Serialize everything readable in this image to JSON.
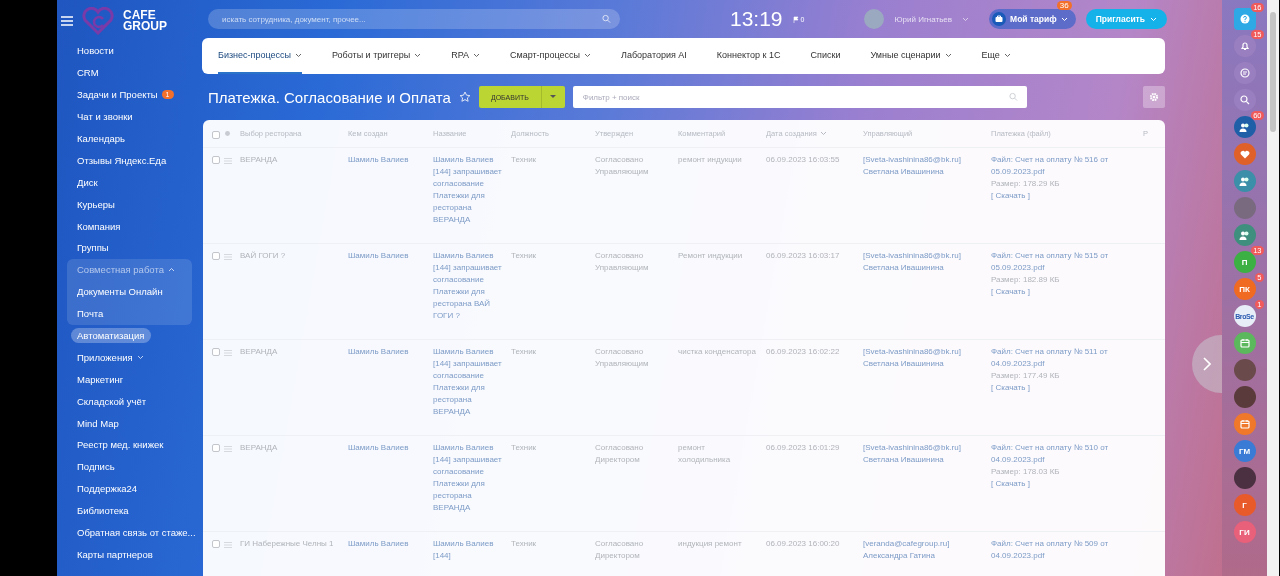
{
  "logo": {
    "lines": [
      "CAFE",
      "GROUP"
    ]
  },
  "header": {
    "search": {
      "placeholder": "искать сотрудника, документ, прочее..."
    },
    "clock": "13:19",
    "flag_count": "0",
    "user_name": "Юрий Игнатьев",
    "tariff": {
      "label": "Мой тариф",
      "badge": "36"
    },
    "invite": "Пригласить"
  },
  "sidebar": {
    "items": [
      {
        "kind": "link",
        "label": "Новости",
        "selected": false
      },
      {
        "kind": "link",
        "label": "CRM",
        "selected": false
      },
      {
        "kind": "link",
        "label": "Задачи и Проекты",
        "badge": "1",
        "selected": false
      },
      {
        "kind": "link",
        "label": "Чат и звонки",
        "selected": false
      },
      {
        "kind": "link",
        "label": "Календарь",
        "selected": false
      },
      {
        "kind": "link",
        "label": "Отзывы Яндекс.Еда",
        "selected": false
      },
      {
        "kind": "link",
        "label": "Диск",
        "selected": false
      },
      {
        "kind": "link",
        "label": "Курьеры",
        "selected": false
      },
      {
        "kind": "link",
        "label": "Компания",
        "selected": false
      },
      {
        "kind": "link",
        "label": "Группы",
        "selected": false
      },
      {
        "kind": "group",
        "label": "Совместная работа",
        "expanded": true,
        "selected": false,
        "children": [
          {
            "kind": "link",
            "label": "Документы Онлайн",
            "selected": false
          },
          {
            "kind": "link",
            "label": "Почта",
            "selected": false
          }
        ]
      },
      {
        "kind": "link",
        "label": "Автоматизация",
        "selected": true
      },
      {
        "kind": "group",
        "label": "Приложения",
        "expanded": false,
        "selected": false
      },
      {
        "kind": "link",
        "label": "Маркетинг",
        "selected": false
      },
      {
        "kind": "link",
        "label": "Складской учёт",
        "selected": false
      },
      {
        "kind": "link",
        "label": "Mind Map",
        "selected": false
      },
      {
        "kind": "link",
        "label": "Реестр мед. книжек",
        "selected": false
      },
      {
        "kind": "link",
        "label": "Подпись",
        "selected": false
      },
      {
        "kind": "link",
        "label": "Поддержка24",
        "selected": false
      },
      {
        "kind": "link",
        "label": "Библиотека",
        "selected": false
      },
      {
        "kind": "link",
        "label": "Обратная связь от стаже...",
        "selected": false
      },
      {
        "kind": "link",
        "label": "Карты партнеров",
        "selected": false
      }
    ]
  },
  "nav": {
    "tabs": [
      {
        "label": "Бизнес-процессы",
        "dropdown": true,
        "selected": true
      },
      {
        "label": "Роботы и триггеры",
        "dropdown": true,
        "selected": false
      },
      {
        "label": "RPA",
        "dropdown": true,
        "selected": false
      },
      {
        "label": "Смарт-процессы",
        "dropdown": true,
        "selected": false
      },
      {
        "label": "Лаборатория AI",
        "dropdown": false,
        "selected": false
      },
      {
        "label": "Коннектор к 1С",
        "dropdown": false,
        "selected": false
      },
      {
        "label": "Списки",
        "dropdown": false,
        "selected": false
      },
      {
        "label": "Умные сценарии",
        "dropdown": true,
        "selected": false
      },
      {
        "label": "Еще",
        "dropdown": true,
        "selected": false
      }
    ]
  },
  "page": {
    "title": "Платежка. Согласование и Оплата",
    "starred": false,
    "add_button": "ДОБАВИТЬ",
    "filter": {
      "placeholder": "Фильтр + поиск"
    }
  },
  "table": {
    "select_all_checked": false,
    "columns": [
      {
        "label": "Выбор ресторана",
        "sorted": false
      },
      {
        "label": "Кем создан",
        "sorted": false
      },
      {
        "label": "Название",
        "sorted": false
      },
      {
        "label": "Должность",
        "sorted": false
      },
      {
        "label": "Утвержден",
        "sorted": false
      },
      {
        "label": "Комментарий",
        "sorted": false
      },
      {
        "label": "Дата создания",
        "sorted": true
      },
      {
        "label": "Управляющий",
        "sorted": false
      },
      {
        "label": "Платежка (файл)",
        "sorted": false
      },
      {
        "label": "Р",
        "sorted": false
      }
    ],
    "rows": [
      {
        "checked": false,
        "restaurant": "ВЕРАНДА",
        "creator": "Шамиль Валиев",
        "title": "Шамиль Валиев [144] запрашивает согласование Платежки для ресторана ВЕРАНДА",
        "position": "Техник",
        "approval": "Согласовано Управляющим",
        "comment": "ремонт индукции",
        "created": "06.09.2023 16:03:55",
        "manager": "[Sveta-ivashinina86@bk.ru] Светлана Ивашинина",
        "file": "Файл: Счет на оплату № 516 от 05.09.2023.pdf",
        "file_size": "Размер: 178.29 КБ",
        "download": "[ Скачать ]"
      },
      {
        "checked": false,
        "restaurant": "ВАЙ ГОГИ ?",
        "creator": "Шамиль Валиев",
        "title": "Шамиль Валиев [144] запрашивает согласование Платежки для ресторана ВАЙ ГОГИ ?",
        "position": "Техник",
        "approval": "Согласовано Управляющим",
        "comment": "Ремонт индукции",
        "created": "06.09.2023 16:03:17",
        "manager": "[Sveta-ivashinina86@bk.ru] Светлана Ивашинина",
        "file": "Файл: Счет на оплату № 515 от 05.09.2023.pdf",
        "file_size": "Размер: 182.89 КБ",
        "download": "[ Скачать ]"
      },
      {
        "checked": false,
        "restaurant": "ВЕРАНДА",
        "creator": "Шамиль Валиев",
        "title": "Шамиль Валиев [144] запрашивает согласование Платежки для ресторана ВЕРАНДА",
        "position": "Техник",
        "approval": "Согласовано Управляющим",
        "comment": "чистка конденсатора",
        "created": "06.09.2023 16:02:22",
        "manager": "[Sveta-ivashinina86@bk.ru] Светлана Ивашинина",
        "file": "Файл: Счет на оплату № 511 от 04.09.2023.pdf",
        "file_size": "Размер: 177.49 КБ",
        "download": "[ Скачать ]"
      },
      {
        "checked": false,
        "restaurant": "ВЕРАНДА",
        "creator": "Шамиль Валиев",
        "title": "Шамиль Валиев [144] запрашивает согласование Платежки для ресторана ВЕРАНДА",
        "position": "Техник",
        "approval": "Согласовано Директором",
        "comment": "ремонт холодильника",
        "created": "06.09.2023 16:01:29",
        "manager": "[Sveta-ivashinina86@bk.ru] Светлана Ивашинина",
        "file": "Файл: Счет на оплату № 510 от 04.09.2023.pdf",
        "file_size": "Размер: 178.03 КБ",
        "download": "[ Скачать ]"
      },
      {
        "checked": false,
        "restaurant": "ГИ Набережные Челны 1",
        "creator": "Шамиль Валиев",
        "title": "Шамиль Валиев [144]",
        "position": "Техник",
        "approval": "Согласовано Директором",
        "comment": "индукция ремонт",
        "created": "06.09.2023 16:00:20",
        "manager": "[veranda@cafegroup.ru] Александра Гатина",
        "file": "Файл: Счет на оплату № 509 от 04.09.2023.pdf"
      }
    ]
  },
  "right_rail": {
    "items": [
      {
        "kind": "help",
        "badge": "16",
        "color": "#2fa8e6"
      },
      {
        "kind": "bell",
        "badge": "15",
        "color": "#9a7fc0"
      },
      {
        "kind": "chat",
        "color": "#9a7fc0"
      },
      {
        "kind": "search",
        "color": "#9a7fc0"
      },
      {
        "kind": "group",
        "badge": "60",
        "color": "#1f5fa8"
      },
      {
        "kind": "heart",
        "color": "#e0602a"
      },
      {
        "kind": "group",
        "color": "#3b8fa8"
      },
      {
        "kind": "photo",
        "color": "#7a6a80"
      },
      {
        "kind": "group",
        "color": "#3f8f7f"
      },
      {
        "kind": "initials",
        "label": "П",
        "badge": "13",
        "color": "#3cb043"
      },
      {
        "kind": "initials",
        "label": "ПК",
        "badge": "5",
        "color": "#f06a22"
      },
      {
        "kind": "initials",
        "label": "BroSe",
        "badge": "1",
        "color": "#e8eef8"
      },
      {
        "kind": "calendar",
        "color": "#5cb85c"
      },
      {
        "kind": "photo",
        "color": "#6a4a4a"
      },
      {
        "kind": "photo",
        "color": "#5a3a3a"
      },
      {
        "kind": "calendar",
        "color": "#f0782a"
      },
      {
        "kind": "initials",
        "label": "ГМ",
        "color": "#3a7bd5"
      },
      {
        "kind": "photo",
        "color": "#4a3040"
      },
      {
        "kind": "initials",
        "label": "Г",
        "color": "#e85a2a"
      },
      {
        "kind": "initials",
        "label": "ГИ",
        "color": "#e8607a"
      }
    ]
  }
}
